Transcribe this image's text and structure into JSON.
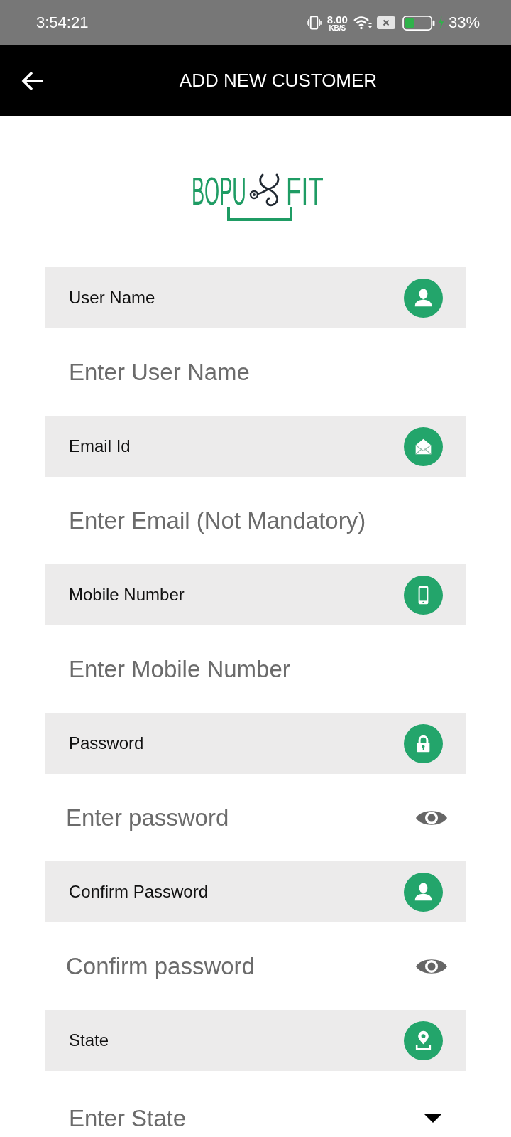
{
  "status_bar": {
    "time": "3:54:21",
    "net_speed": "8.00",
    "net_unit": "KB/S",
    "battery": "33%"
  },
  "header": {
    "title": "ADD NEW CUSTOMER"
  },
  "logo": {
    "left": "BOPU",
    "right": "FIT"
  },
  "fields": [
    {
      "kind": "text",
      "label": "User Name",
      "placeholder": "Enter User Name"
    },
    {
      "kind": "text",
      "label": "Email Id",
      "placeholder": "Enter Email (Not Mandatory)"
    },
    {
      "kind": "text",
      "label": "Mobile Number",
      "placeholder": "Enter Mobile Number"
    },
    {
      "kind": "password",
      "label": "Password",
      "placeholder": "Enter password"
    },
    {
      "kind": "password",
      "label": "Confirm Password",
      "placeholder": "Confirm password"
    },
    {
      "kind": "select",
      "label": "State",
      "placeholder": "Enter State"
    }
  ]
}
